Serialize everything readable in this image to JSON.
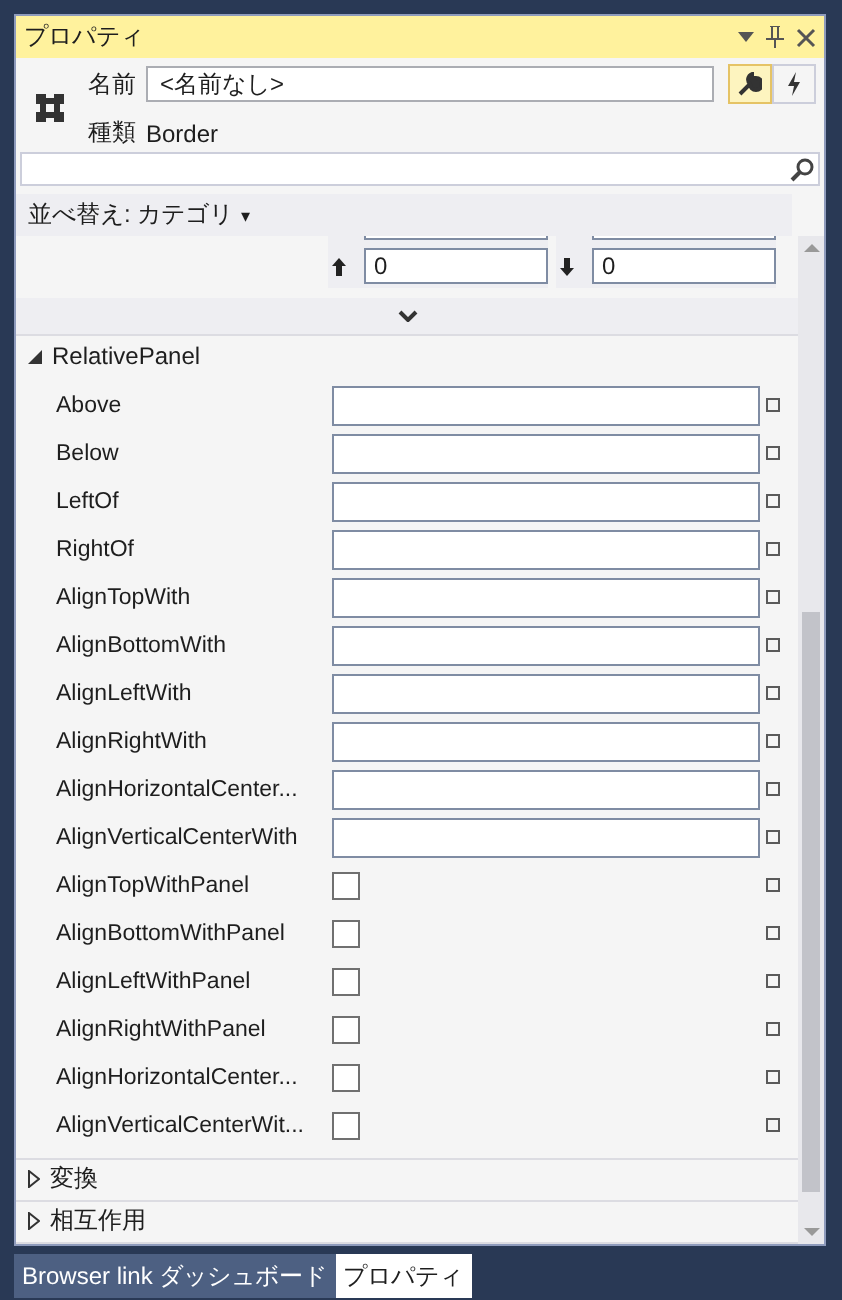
{
  "window": {
    "title": "プロパティ"
  },
  "header": {
    "name_label": "名前",
    "name_value": "<名前なし>",
    "type_label": "種類",
    "type_value": "Border",
    "views": [
      {
        "kind": "properties",
        "selected": true
      },
      {
        "kind": "events",
        "selected": false
      }
    ]
  },
  "sort": {
    "label": "並べ替え: カテゴリ",
    "caret": "▾"
  },
  "layout_rows": [
    {
      "fields": [
        {
          "kind": "plain"
        },
        {
          "kind": "plain"
        }
      ]
    },
    {
      "fields": [
        {
          "kind": "up",
          "value": "0"
        },
        {
          "kind": "down",
          "value": "0"
        }
      ]
    }
  ],
  "sections": [
    {
      "label": "RelativePanel",
      "expanded": true,
      "properties": [
        {
          "label": "Above",
          "kind": "text"
        },
        {
          "label": "Below",
          "kind": "text"
        },
        {
          "label": "LeftOf",
          "kind": "text"
        },
        {
          "label": "RightOf",
          "kind": "text"
        },
        {
          "label": "AlignTopWith",
          "kind": "text"
        },
        {
          "label": "AlignBottomWith",
          "kind": "text"
        },
        {
          "label": "AlignLeftWith",
          "kind": "text"
        },
        {
          "label": "AlignRightWith",
          "kind": "text"
        },
        {
          "label": "AlignHorizontalCenter...",
          "kind": "text"
        },
        {
          "label": "AlignVerticalCenterWith",
          "kind": "text"
        },
        {
          "label": "AlignTopWithPanel",
          "kind": "checkbox",
          "checked": false
        },
        {
          "label": "AlignBottomWithPanel",
          "kind": "checkbox",
          "checked": false
        },
        {
          "label": "AlignLeftWithPanel",
          "kind": "checkbox",
          "checked": false
        },
        {
          "label": "AlignRightWithPanel",
          "kind": "checkbox",
          "checked": false
        },
        {
          "label": "AlignHorizontalCenter...",
          "kind": "checkbox",
          "checked": false
        },
        {
          "label": "AlignVerticalCenterWit...",
          "kind": "checkbox",
          "checked": false
        }
      ]
    },
    {
      "label": "変換",
      "expanded": false
    },
    {
      "label": "相互作用",
      "expanded": false
    }
  ],
  "bottom_tabs": [
    {
      "label": "Browser link ダッシュボード",
      "selected": false
    },
    {
      "label": "プロパティ",
      "selected": true
    }
  ]
}
